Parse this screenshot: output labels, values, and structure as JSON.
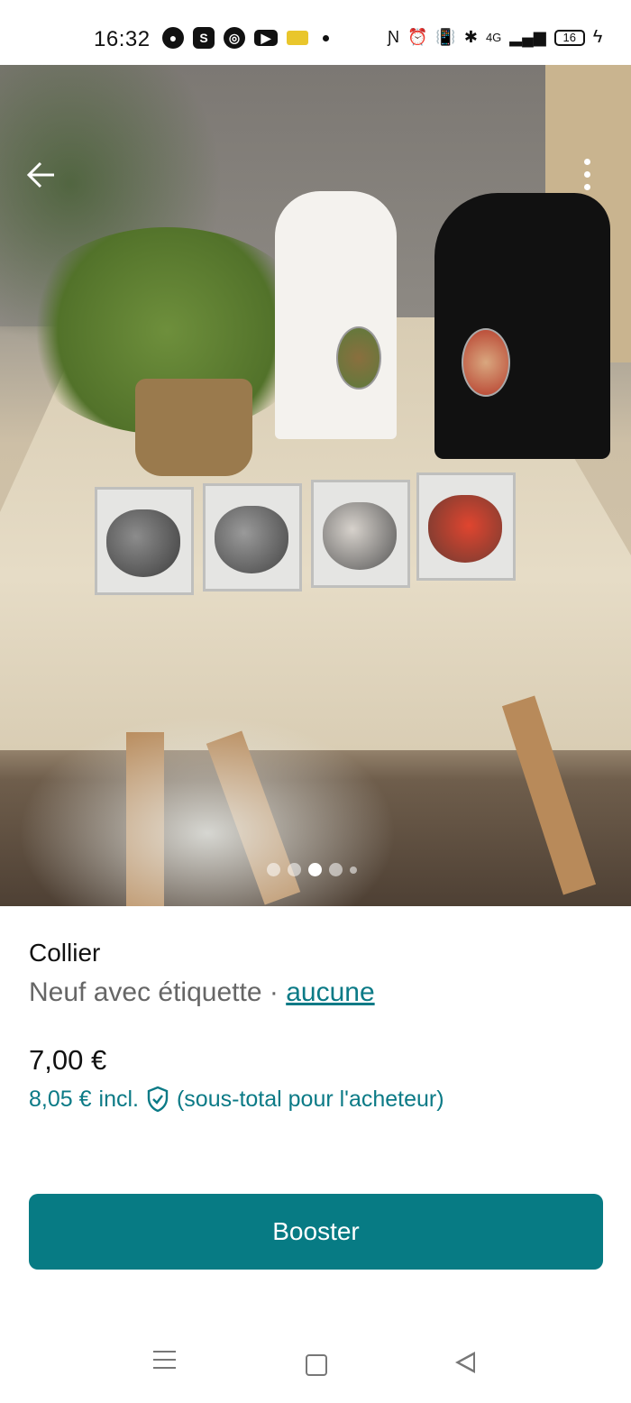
{
  "status_bar": {
    "time": "16:32",
    "battery": "16",
    "network": "4G",
    "icons_left": [
      "chat-icon",
      "s-app-icon",
      "app-icon",
      "youtube-icon",
      "app-yellow-icon",
      "dot-icon"
    ],
    "icons_right": [
      "nfc-icon",
      "alarm-icon",
      "vibrate-icon",
      "bluetooth-icon",
      "signal-icon",
      "battery-icon",
      "charging-icon"
    ]
  },
  "photo": {
    "alt_icons": {
      "back": "back-arrow-icon",
      "menu": "more-vert-icon"
    },
    "carousel": {
      "count": 5,
      "active_index": 2
    }
  },
  "item": {
    "title": "Collier",
    "condition": "Neuf avec étiquette",
    "separator": "·",
    "brand_link": "aucune",
    "price": "7,00 €",
    "price_incl_amount": "8,05 €",
    "price_incl_label": "incl.",
    "price_incl_note": "(sous-total pour l'acheteur)"
  },
  "actions": {
    "booster_label": "Booster"
  },
  "colors": {
    "accent": "#077b84",
    "link": "#0b7a86"
  },
  "nav_bar": [
    "menu-icon",
    "home-icon",
    "back-icon"
  ]
}
